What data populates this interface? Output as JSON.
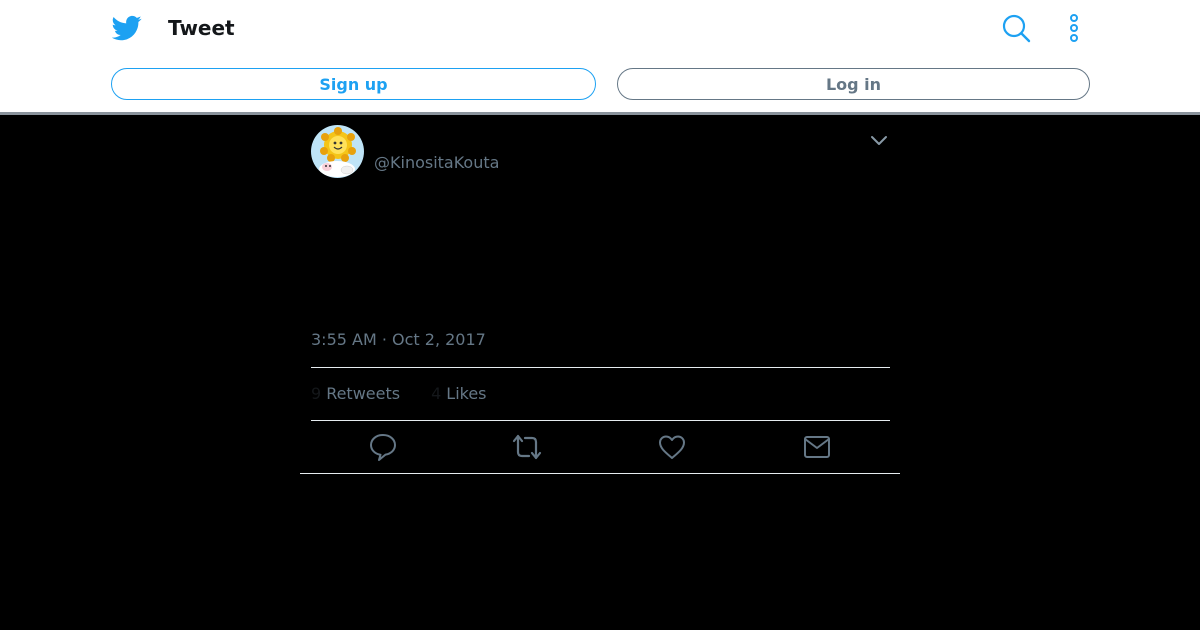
{
  "header": {
    "title": "Tweet",
    "signup_label": "Sign up",
    "login_label": "Log in"
  },
  "tweet": {
    "handle": "@KinositaKouta",
    "timestamp": "3:55 AM · Oct 2, 2017",
    "retweets_count": "9",
    "retweets_label": "Retweets",
    "likes_count": "4",
    "likes_label": "Likes"
  },
  "icons": {
    "logo": "twitter-bird-icon",
    "search": "search-icon",
    "more": "more-vertical-icon",
    "caret": "chevron-down-icon",
    "reply": "reply-icon",
    "retweet": "retweet-icon",
    "like": "heart-icon",
    "dm": "envelope-icon"
  },
  "colors": {
    "brand": "#1da1f2",
    "secondary_text": "#657786",
    "primary_text": "#14171a",
    "background": "#000000"
  }
}
